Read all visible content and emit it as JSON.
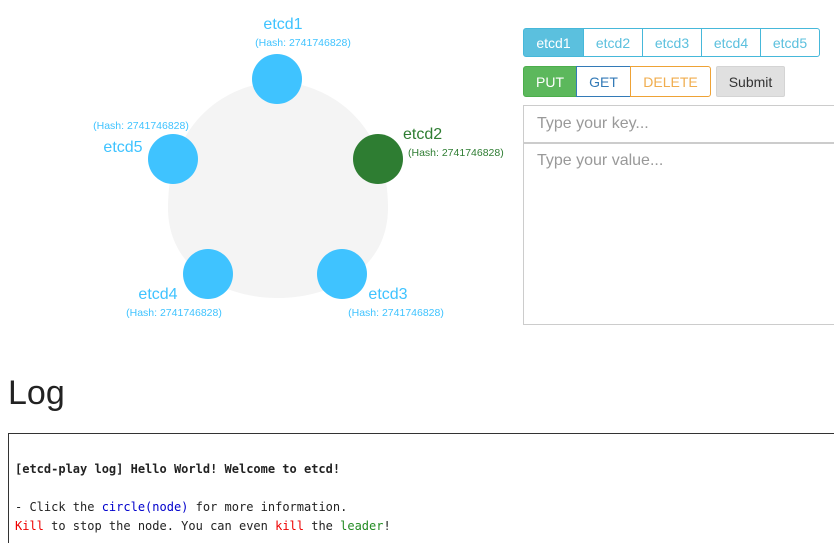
{
  "cluster": {
    "nodes": [
      {
        "name": "etcd1",
        "hash": "(Hash: 2741746828)",
        "color": "#3fc3ff",
        "label_color": "#3fc3ff"
      },
      {
        "name": "etcd2",
        "hash": "(Hash: 2741746828)",
        "color": "#2e7d32",
        "label_color": "#2e7d32"
      },
      {
        "name": "etcd3",
        "hash": "(Hash: 2741746828)",
        "color": "#3fc3ff",
        "label_color": "#3fc3ff"
      },
      {
        "name": "etcd4",
        "hash": "(Hash: 2741746828)",
        "color": "#3fc3ff",
        "label_color": "#3fc3ff"
      },
      {
        "name": "etcd5",
        "hash": "(Hash: 2741746828)",
        "color": "#3fc3ff",
        "label_color": "#3fc3ff"
      }
    ],
    "background_color": "#f4f4f4",
    "leader": "etcd2"
  },
  "tabs": [
    {
      "label": "etcd1",
      "active": true
    },
    {
      "label": "etcd2",
      "active": false
    },
    {
      "label": "etcd3",
      "active": false
    },
    {
      "label": "etcd4",
      "active": false
    },
    {
      "label": "etcd5",
      "active": false
    }
  ],
  "ops": {
    "put": "PUT",
    "get": "GET",
    "delete": "DELETE",
    "submit": "Submit"
  },
  "form": {
    "key_placeholder": "Type your key...",
    "value_placeholder": "Type your value..."
  },
  "log": {
    "title": "Log",
    "header": "[etcd-play log] Hello World! Welcome to etcd!",
    "line1": {
      "pre": "- Click the ",
      "link": "circle(node)",
      "post": " for more information."
    },
    "line2": {
      "kill1": "Kill",
      "mid1": " to stop the node. You can even ",
      "kill2": "kill",
      "mid2": " the ",
      "leader": "leader",
      "end": "!"
    }
  }
}
